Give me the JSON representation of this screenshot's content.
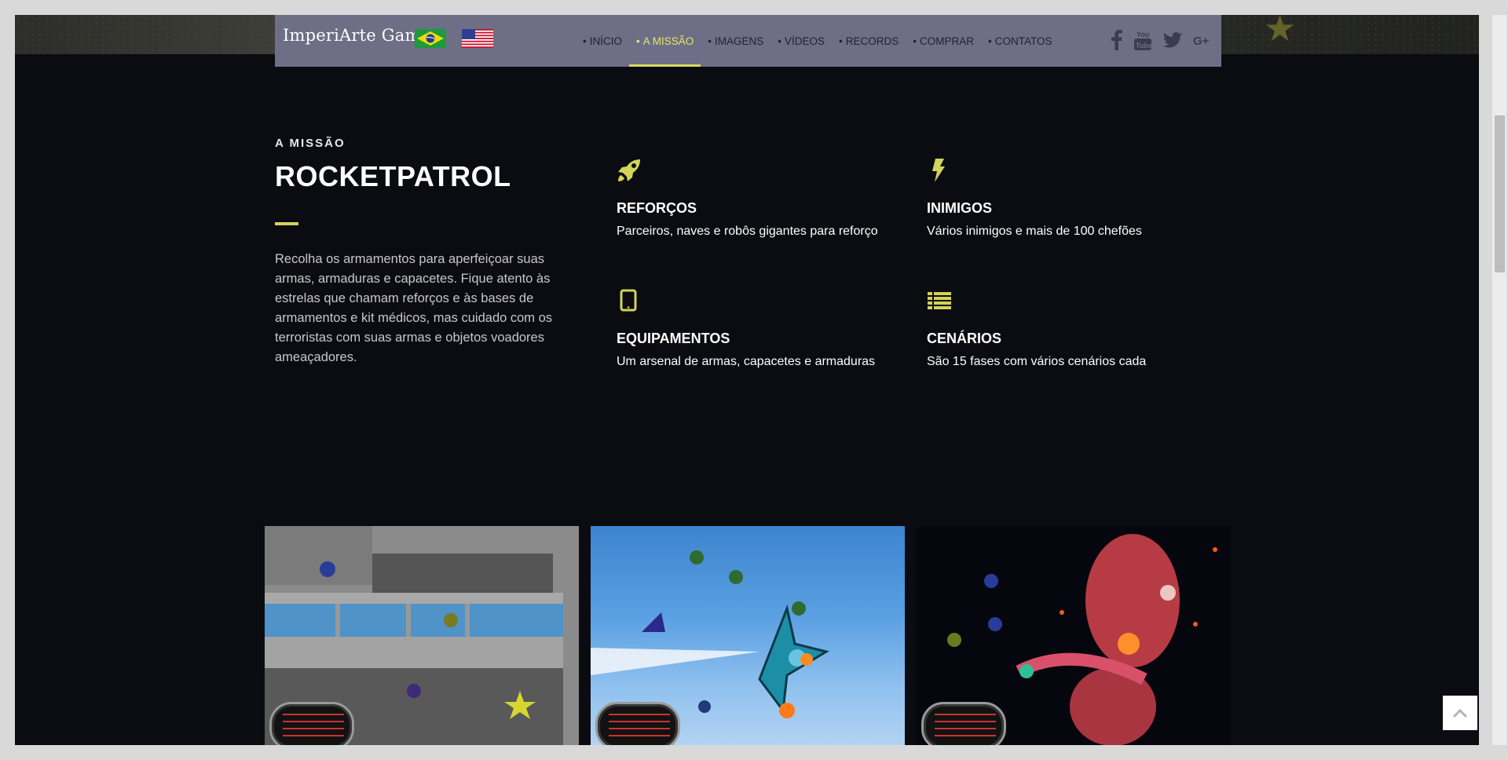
{
  "nav": {
    "brand": "ImperiArte Games",
    "items": [
      {
        "label": "INÍCIO",
        "active": false
      },
      {
        "label": "A MISSÃO",
        "active": true
      },
      {
        "label": "IMAGENS",
        "active": false
      },
      {
        "label": "VÍDEOS",
        "active": false
      },
      {
        "label": "RECORDS",
        "active": false
      },
      {
        "label": "COMPRAR",
        "active": false
      },
      {
        "label": "CONTATOS",
        "active": false
      }
    ],
    "flags": [
      "brazil-flag-icon",
      "usa-flag-icon"
    ],
    "social": [
      "facebook-icon",
      "youtube-icon",
      "twitter-icon",
      "google-plus-icon"
    ]
  },
  "mission": {
    "kicker": "A MISSÃO",
    "title": "ROCKETPATROL",
    "description": "Recolha os armamentos para aperfeiçoar suas armas, armaduras e capacetes. Fique atento às estrelas que chamam reforços e às bases de armamentos e kit médicos, mas cuidado com os terroristas com suas armas e objetos voadores ameaçadores.",
    "features": [
      {
        "icon": "rocket-icon",
        "title": "REFORÇOS",
        "text": "Parceiros, naves e robôs gigantes para reforço"
      },
      {
        "icon": "bolt-icon",
        "title": "INIMIGOS",
        "text": "Vários inimigos e mais de 100 chefões"
      },
      {
        "icon": "tablet-icon",
        "title": "EQUIPAMENTOS",
        "text": "Um arsenal de armas, capacetes e armaduras"
      },
      {
        "icon": "list-icon",
        "title": "CENÁRIOS",
        "text": "São 15 fases com vários cenários cada"
      }
    ]
  },
  "colors": {
    "accent": "#d3d359",
    "nav_bg": "#6e6f86",
    "page_bg": "#0b0b12"
  }
}
